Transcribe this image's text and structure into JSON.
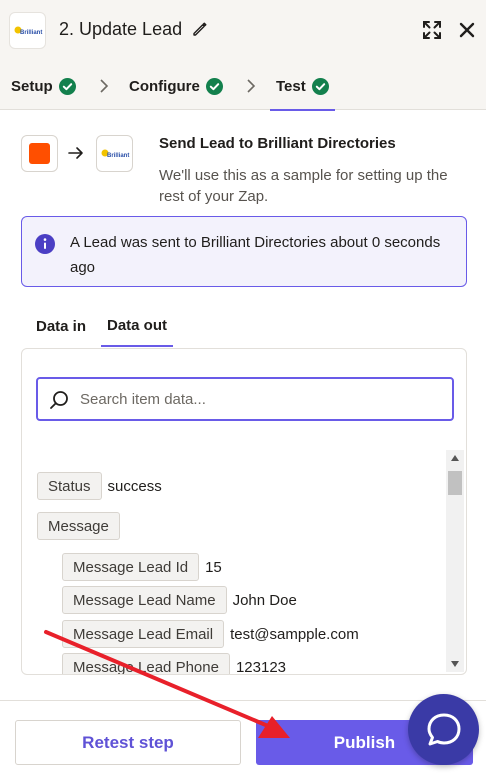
{
  "header": {
    "title": "2. Update Lead",
    "logo_text": "Brilliant",
    "icons": {
      "edit": "pencil-icon",
      "expand": "expand-icon",
      "close": "close-icon"
    }
  },
  "steps": [
    {
      "label": "Setup",
      "status": "complete"
    },
    {
      "label": "Configure",
      "status": "complete"
    },
    {
      "label": "Test",
      "status": "complete",
      "active": true
    }
  ],
  "summary": {
    "title": "Send Lead to Brilliant Directories",
    "description": "We'll use this as a sample for setting up the rest of your Zap."
  },
  "alert": {
    "message": "A Lead was sent to Brilliant Directories about 0 seconds ago"
  },
  "data_tabs": [
    {
      "label": "Data in",
      "active": false
    },
    {
      "label": "Data out",
      "active": true
    }
  ],
  "search": {
    "placeholder": "Search item data...",
    "value": ""
  },
  "data": [
    {
      "key": "Status",
      "value": "success",
      "level": 0
    },
    {
      "key": "Message",
      "value": "",
      "level": 0
    },
    {
      "key": "Message Lead Id",
      "value": "15",
      "level": 1
    },
    {
      "key": "Message Lead Name",
      "value": "John Doe",
      "level": 1
    },
    {
      "key": "Message Lead Email",
      "value": "test@sampple.com",
      "level": 1
    },
    {
      "key": "Message Lead Phone",
      "value": "123123",
      "level": 1
    }
  ],
  "footer": {
    "retest_label": "Retest step",
    "publish_label": "Publish"
  },
  "colors": {
    "accent": "#695be8",
    "success": "#13804d",
    "zapier_orange": "#ff4f00",
    "annotation_arrow": "#e8202a"
  }
}
